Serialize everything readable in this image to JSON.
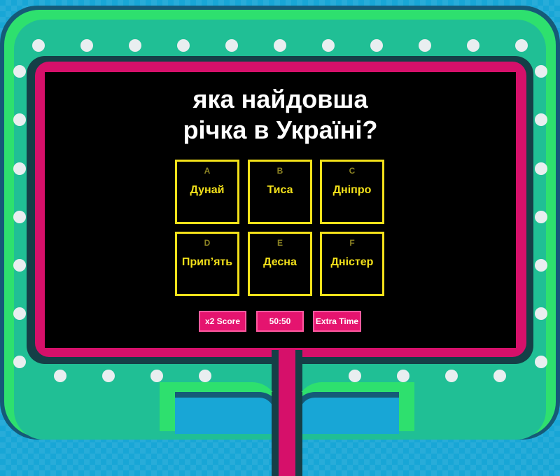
{
  "question": {
    "line1": "яка найдовша",
    "line2": "річка в Україні?"
  },
  "answers": [
    {
      "letter": "A",
      "label": "Дунай"
    },
    {
      "letter": "B",
      "label": "Тиса"
    },
    {
      "letter": "C",
      "label": "Дніпро"
    },
    {
      "letter": "D",
      "label": "Прип’ять"
    },
    {
      "letter": "E",
      "label": "Десна"
    },
    {
      "letter": "F",
      "label": "Дністер"
    }
  ],
  "powerups": {
    "double_score": "x2 Score",
    "fifty_fifty": "50:50",
    "extra_time": "Extra Time"
  },
  "colors": {
    "background": "#18a6d6",
    "frame_green": "#2ee06e",
    "frame_pink": "#d6106a",
    "screen": "#000000",
    "answer_accent": "#f3e11a",
    "powerup": "#e5146f"
  }
}
